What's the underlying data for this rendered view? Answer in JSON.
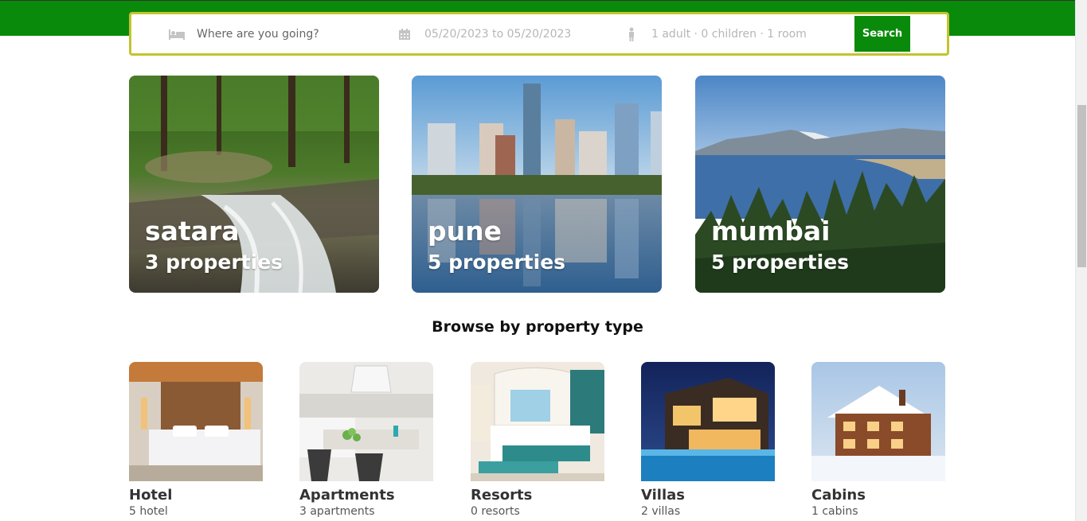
{
  "search": {
    "destination_placeholder": "Where are you going?",
    "dates": "05/20/2023 to 05/20/2023",
    "guests": "1 adult · 0 children · 1 room",
    "button_label": "Search"
  },
  "cities": [
    {
      "name": "satara",
      "count": "3 properties"
    },
    {
      "name": "pune",
      "count": "5 properties"
    },
    {
      "name": "mumbai",
      "count": "5 properties"
    }
  ],
  "section_title": "Browse by property type",
  "property_types": [
    {
      "name": "Hotel",
      "count": "5 hotel"
    },
    {
      "name": "Apartments",
      "count": "3 apartments"
    },
    {
      "name": "Resorts",
      "count": "0 resorts"
    },
    {
      "name": "Villas",
      "count": "2 villas"
    },
    {
      "name": "Cabins",
      "count": "1 cabins"
    }
  ],
  "colors": {
    "brand_green": "#0a8a0a",
    "search_border": "#c3c42f"
  }
}
